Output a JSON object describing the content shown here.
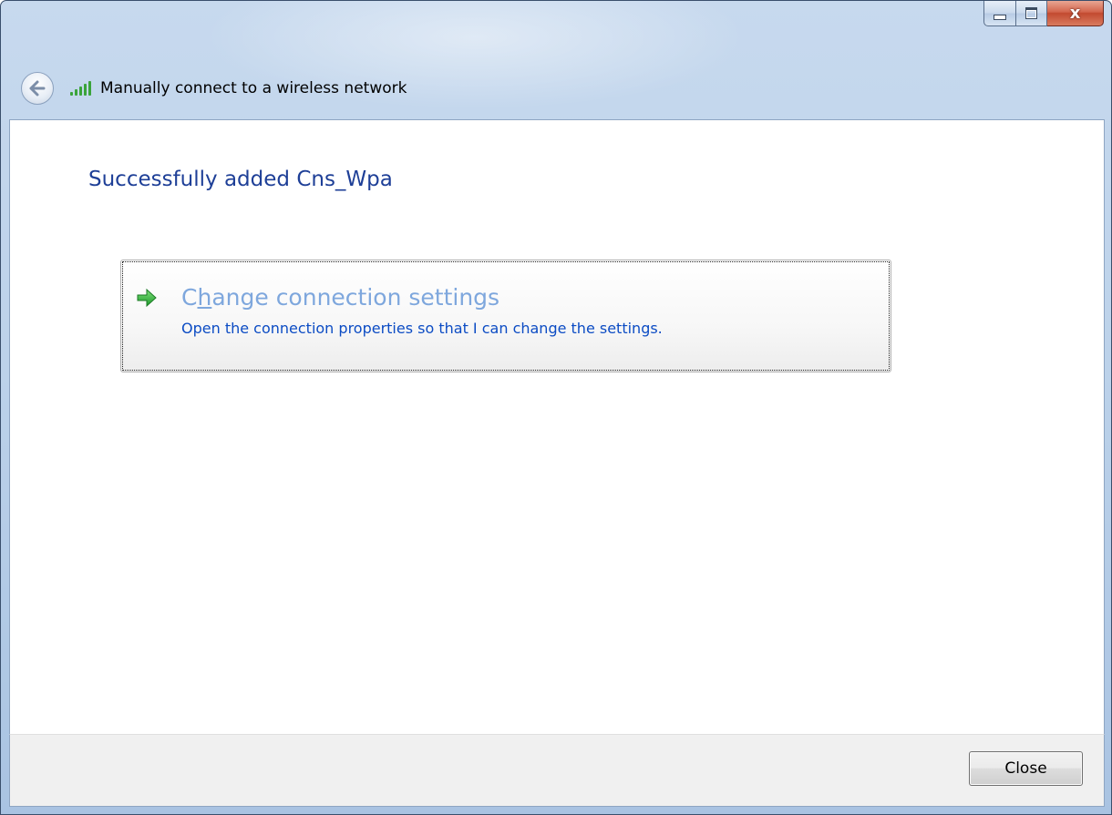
{
  "window": {
    "title": "Manually connect to a wireless network",
    "close_glyph": "x"
  },
  "main": {
    "heading": "Successfully added Cns_Wpa",
    "command_link": {
      "title_prefix": "C",
      "title_accel": "h",
      "title_suffix": "ange connection settings",
      "description": "Open the connection properties so that I can change the settings.",
      "icon": "green-arrow-icon"
    }
  },
  "footer": {
    "close_label": "Close"
  },
  "colors": {
    "heading": "#1e3f97",
    "link_title": "#7ea7dd",
    "link_desc": "#0c4cc4",
    "arrow": "#2fae3a"
  }
}
